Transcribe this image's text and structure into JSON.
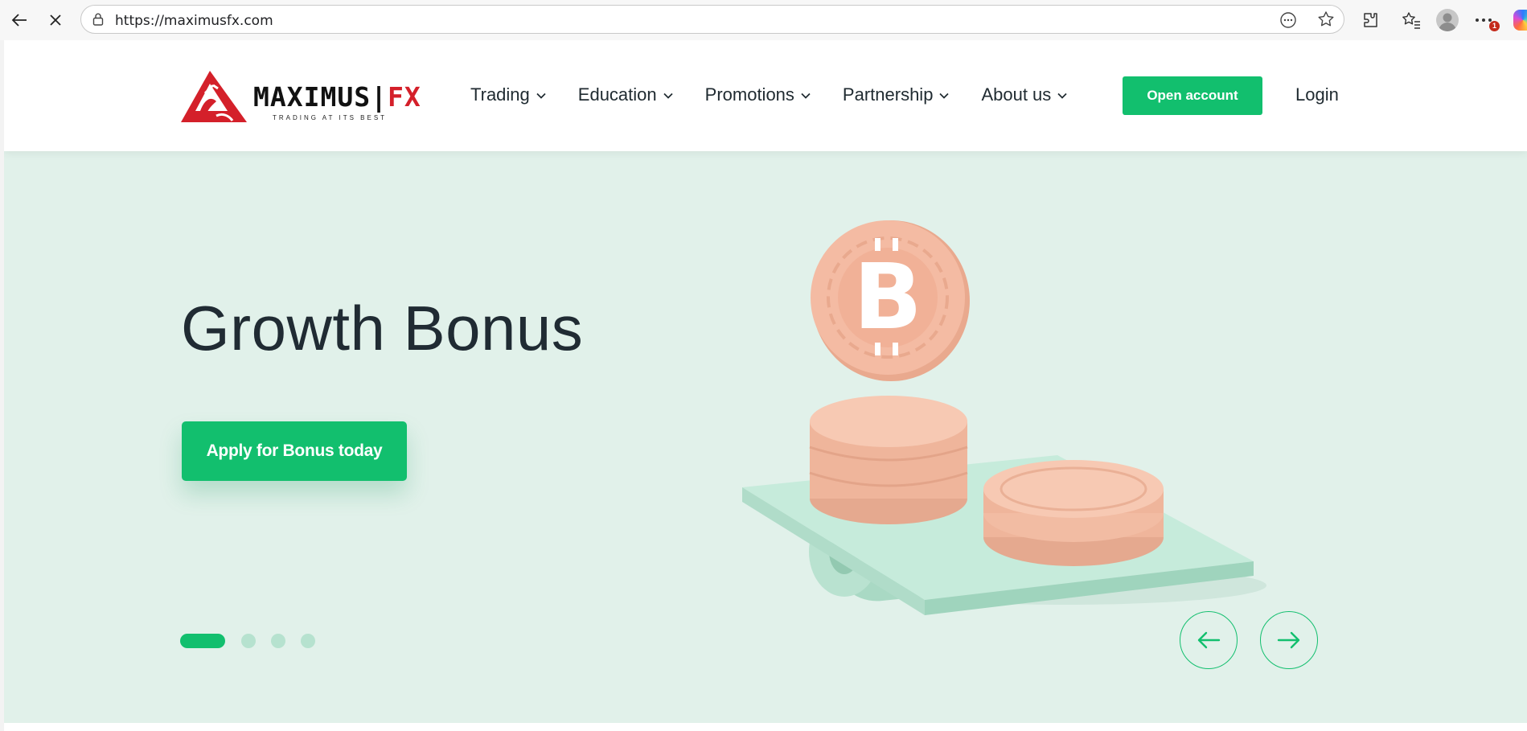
{
  "browser": {
    "url": "https://maximusfx.com",
    "notification_count": "1"
  },
  "site": {
    "brand_name": "MAXIMUS",
    "brand_suffix": "FX",
    "tagline": "TRADING AT ITS BEST",
    "nav": [
      {
        "label": "Trading"
      },
      {
        "label": "Education"
      },
      {
        "label": "Promotions"
      },
      {
        "label": "Partnership"
      },
      {
        "label": "About us"
      }
    ],
    "open_account_label": "Open account",
    "login_label": "Login"
  },
  "hero": {
    "title": "Growth Bonus",
    "cta_label": "Apply for Bonus today",
    "slides_total": 4,
    "active_slide": 1
  },
  "colors": {
    "accent": "#12bf6e",
    "hero_bg": "#e1f1ea",
    "brand_red": "#d4202a",
    "coin": "#f2b9a1",
    "seesaw": "#bfe6d6"
  },
  "icons": {
    "back": "back-arrow-icon",
    "stop": "stop-loading-icon",
    "lock": "lock-icon",
    "reader": "reader-mode-icon",
    "favorite": "star-icon",
    "extensions": "puzzle-icon",
    "favorites_bar": "favorites-icon",
    "more": "more-icon",
    "prev": "arrow-left-icon",
    "next": "arrow-right-icon"
  }
}
